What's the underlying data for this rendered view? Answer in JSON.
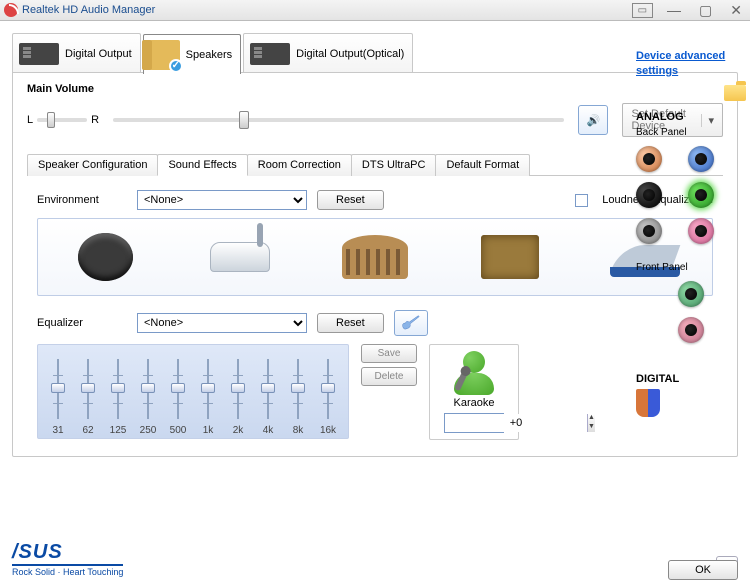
{
  "window": {
    "title": "Realtek HD Audio Manager"
  },
  "toptabs": {
    "digital_output": "Digital Output",
    "speakers": "Speakers",
    "digital_output_optical": "Digital Output(Optical)"
  },
  "main_volume": {
    "label": "Main Volume",
    "left": "L",
    "right": "R",
    "set_default": "Set Default Device"
  },
  "subtabs": {
    "speaker_config": "Speaker Configuration",
    "sound_effects": "Sound Effects",
    "room_correction": "Room Correction",
    "dts": "DTS UltraPC",
    "default_format": "Default Format"
  },
  "environment": {
    "label": "Environment",
    "value": "<None>",
    "reset": "Reset",
    "loudness": "Loudness Equalization"
  },
  "equalizer": {
    "label": "Equalizer",
    "value": "<None>",
    "reset": "Reset",
    "save": "Save",
    "delete": "Delete",
    "bands": [
      "31",
      "62",
      "125",
      "250",
      "500",
      "1k",
      "2k",
      "4k",
      "8k",
      "16k"
    ]
  },
  "karaoke": {
    "label": "Karaoke",
    "value": "+0"
  },
  "sidebar": {
    "advanced": "Device advanced settings",
    "analog": "ANALOG",
    "back_panel": "Back Panel",
    "front_panel": "Front Panel",
    "digital": "DIGITAL"
  },
  "asus": {
    "brand": "/SUS",
    "tag": "Rock Solid · Heart Touching"
  },
  "ok": "OK"
}
